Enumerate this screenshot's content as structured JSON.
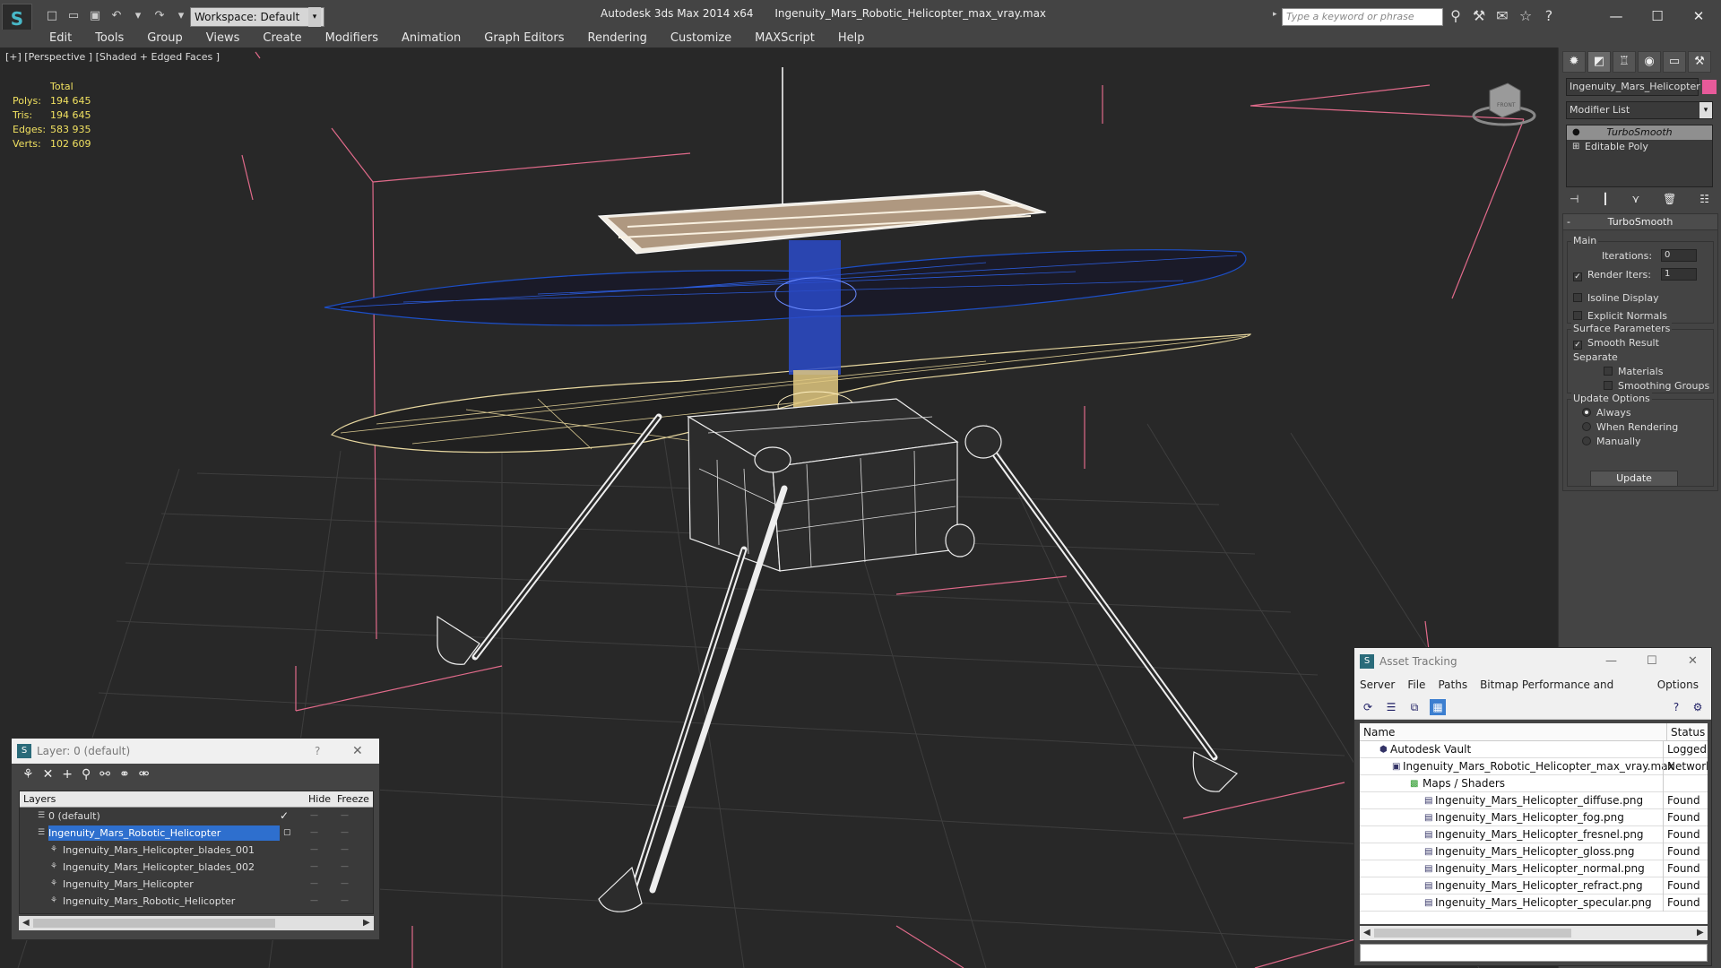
{
  "titlebar": {
    "workspace_label": "Workspace: Default",
    "app_name": "Autodesk 3ds Max  2014 x64",
    "file_name": "Ingenuity_Mars_Robotic_Helicopter_max_vray.max",
    "search_placeholder": "Type a keyword or phrase"
  },
  "menu": [
    "Edit",
    "Tools",
    "Group",
    "Views",
    "Create",
    "Modifiers",
    "Animation",
    "Graph Editors",
    "Rendering",
    "Customize",
    "MAXScript",
    "Help"
  ],
  "viewport": {
    "label": "[+] [Perspective ] [Shaded + Edged Faces ]",
    "stats": {
      "header": "Total",
      "rows": [
        {
          "k": "Polys:",
          "v": "194 645"
        },
        {
          "k": "Tris:",
          "v": "194 645"
        },
        {
          "k": "Edges:",
          "v": "583 935"
        },
        {
          "k": "Verts:",
          "v": "102 609"
        }
      ]
    },
    "viewcube_label": "FRONT"
  },
  "command_panel": {
    "object_name": "Ingenuity_Mars_Helicopter",
    "object_color": "#e75a9a",
    "modifier_list": "Modifier List",
    "stack": [
      "TurboSmooth",
      "Editable Poly"
    ],
    "rollout_title": "TurboSmooth",
    "main_group": "Main",
    "iterations_label": "Iterations:",
    "iterations_value": "0",
    "render_iters_label": "Render Iters:",
    "render_iters_value": "1",
    "isoline_label": "Isoline Display",
    "explicit_normals_label": "Explicit Normals",
    "surface_group": "Surface Parameters",
    "smooth_result_label": "Smooth Result",
    "separate_label": "Separate",
    "materials_label": "Materials",
    "smoothing_groups_label": "Smoothing Groups",
    "update_group": "Update Options",
    "always_label": "Always",
    "when_rendering_label": "When Rendering",
    "manually_label": "Manually",
    "update_button": "Update"
  },
  "layer_panel": {
    "title": "Layer: 0 (default)",
    "help": "?",
    "col_layers": "Layers",
    "col_hide": "Hide",
    "col_freeze": "Freeze",
    "rows": [
      {
        "name": "0 (default)",
        "level": 1,
        "selected": false,
        "check": true
      },
      {
        "name": "Ingenuity_Mars_Robotic_Helicopter",
        "level": 1,
        "selected": true,
        "check": false
      },
      {
        "name": "Ingenuity_Mars_Helicopter_blades_001",
        "level": 2,
        "selected": false,
        "check": false
      },
      {
        "name": "Ingenuity_Mars_Helicopter_blades_002",
        "level": 2,
        "selected": false,
        "check": false
      },
      {
        "name": "Ingenuity_Mars_Helicopter",
        "level": 2,
        "selected": false,
        "check": false
      },
      {
        "name": "Ingenuity_Mars_Robotic_Helicopter",
        "level": 2,
        "selected": false,
        "check": false
      }
    ]
  },
  "asset_panel": {
    "title": "Asset Tracking",
    "menu": [
      "Server",
      "File",
      "Paths",
      "Bitmap Performance and Memory",
      "Options"
    ],
    "col_name": "Name",
    "col_status": "Status",
    "rows": [
      {
        "name": "Autodesk Vault",
        "status": "Logged Out",
        "level": 1,
        "icon": "vault"
      },
      {
        "name": "Ingenuity_Mars_Robotic_Helicopter_max_vray.max",
        "status": "Network",
        "level": 2,
        "icon": "max"
      },
      {
        "name": "Maps / Shaders",
        "status": "",
        "level": 3,
        "icon": "folder"
      },
      {
        "name": "Ingenuity_Mars_Helicopter_diffuse.png",
        "status": "Found",
        "level": 4,
        "icon": "bitmap"
      },
      {
        "name": "Ingenuity_Mars_Helicopter_fog.png",
        "status": "Found",
        "level": 4,
        "icon": "bitmap"
      },
      {
        "name": "Ingenuity_Mars_Helicopter_fresnel.png",
        "status": "Found",
        "level": 4,
        "icon": "bitmap"
      },
      {
        "name": "Ingenuity_Mars_Helicopter_gloss.png",
        "status": "Found",
        "level": 4,
        "icon": "bitmap"
      },
      {
        "name": "Ingenuity_Mars_Helicopter_normal.png",
        "status": "Found",
        "level": 4,
        "icon": "bitmap"
      },
      {
        "name": "Ingenuity_Mars_Helicopter_refract.png",
        "status": "Found",
        "level": 4,
        "icon": "bitmap"
      },
      {
        "name": "Ingenuity_Mars_Helicopter_specular.png",
        "status": "Found",
        "level": 4,
        "icon": "bitmap"
      }
    ]
  }
}
